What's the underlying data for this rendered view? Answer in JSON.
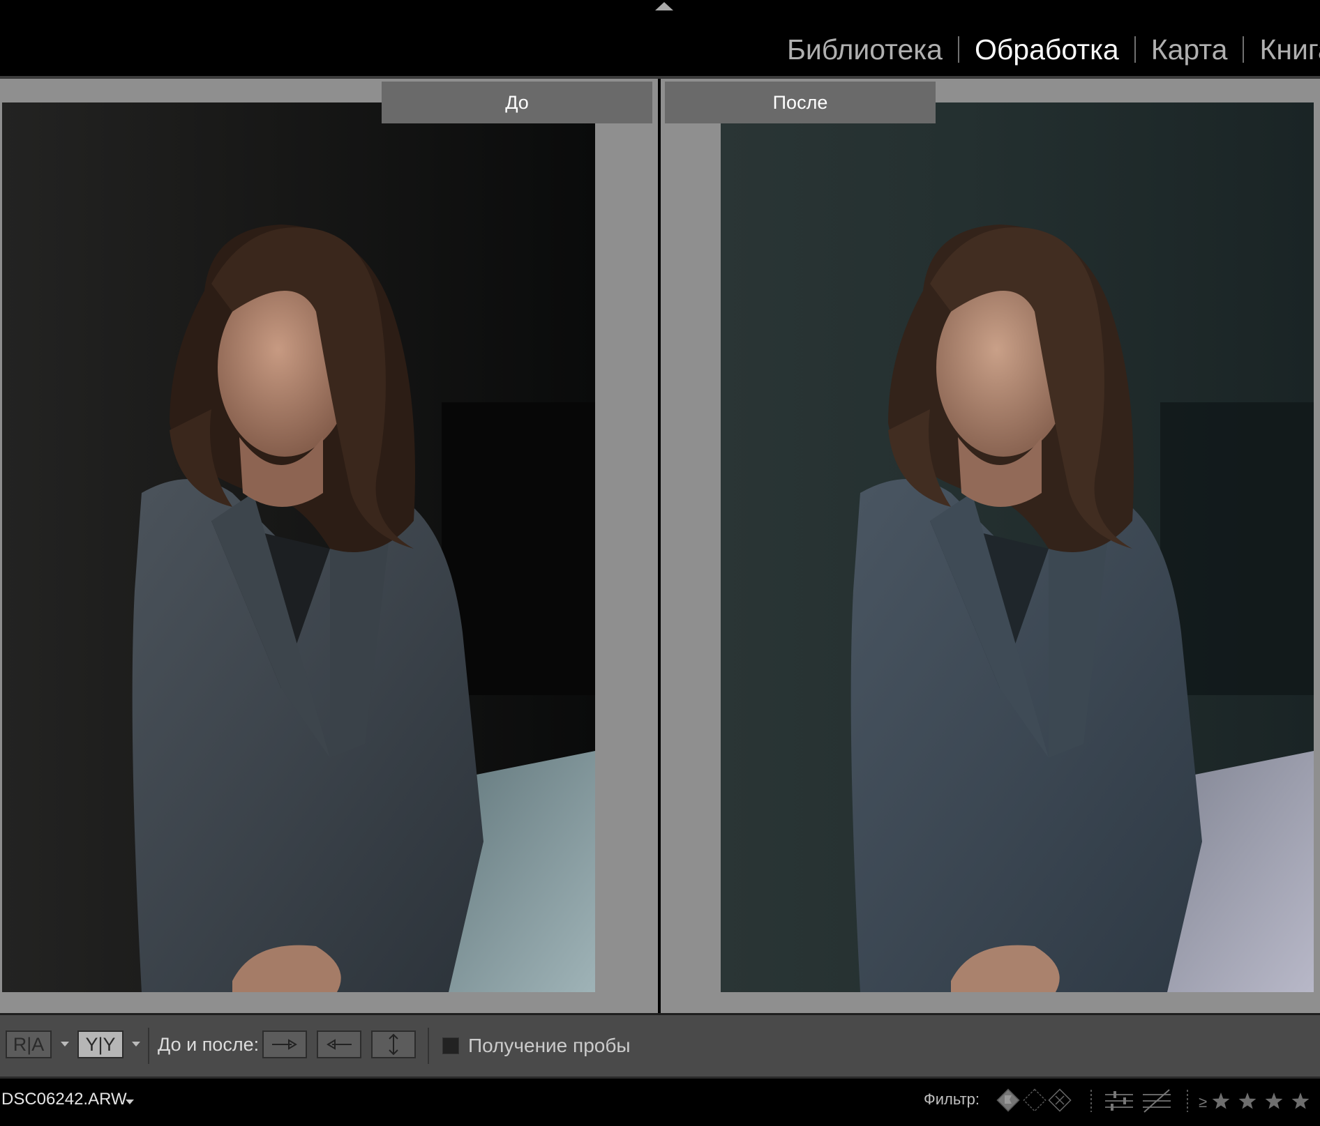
{
  "modules": [
    {
      "label": "Библиотека",
      "active": false
    },
    {
      "label": "Обработка",
      "active": true
    },
    {
      "label": "Карта",
      "active": false
    },
    {
      "label": "Книга",
      "active": false
    }
  ],
  "compare": {
    "before_label": "До",
    "after_label": "После"
  },
  "toolbar": {
    "view_ra_label": "R|A",
    "view_yy_label": "Y|Y",
    "before_after_label": "До и после:",
    "sample_label": "Получение пробы",
    "sample_checked": false
  },
  "filmstrip": {
    "filename": "DSC06242.ARW",
    "filter_label": "Фильтр:",
    "rating_operator": "≥",
    "stars_shown": 4
  },
  "icons": {
    "collapse": "triangle-up-icon",
    "copy_before_to_after": "arrow-right-icon",
    "copy_after_to_before": "arrow-left-icon",
    "swap": "swap-vertical-icon",
    "flags": "flag-filter-icons",
    "edits": "edit-filter-icons",
    "star": "star-icon"
  }
}
